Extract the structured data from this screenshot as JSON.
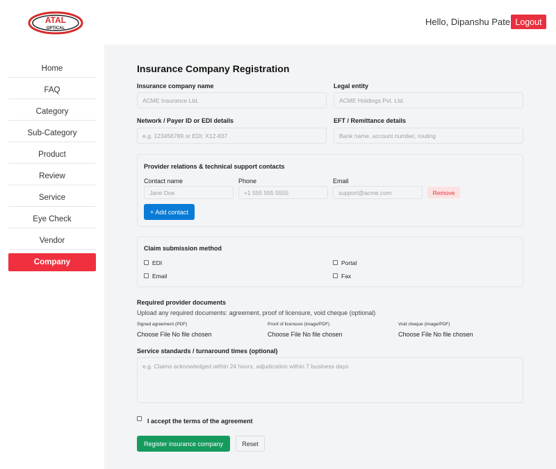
{
  "brand": {
    "logo_top": "ATAL",
    "logo_bottom": "OPTICAL"
  },
  "header": {
    "greeting": "Hello, Dipanshu Patel",
    "logout_label": "Logout"
  },
  "sidebar": {
    "items": [
      {
        "label": "Home"
      },
      {
        "label": "FAQ"
      },
      {
        "label": "Category"
      },
      {
        "label": "Sub-Category"
      },
      {
        "label": "Product"
      },
      {
        "label": "Review"
      },
      {
        "label": "Service"
      },
      {
        "label": "Eye Check"
      },
      {
        "label": "Vendor"
      },
      {
        "label": "Company"
      }
    ],
    "active_index": 9
  },
  "form": {
    "title": "Insurance Company Registration",
    "company_name": {
      "label": "Insurance company name",
      "placeholder": "ACME Insurance Ltd."
    },
    "legal_entity": {
      "label": "Legal entity",
      "placeholder": "ACME Holdings Pvt. Ltd."
    },
    "network": {
      "label": "Network / Payer ID or EDI details",
      "placeholder": "e.g. 123456789 or EDI: X12-837"
    },
    "eft": {
      "label": "EFT / Remittance details",
      "placeholder": "Bank name, account number, routing"
    },
    "contacts": {
      "title": "Provider relations & technical support contacts",
      "col_name": "Contact name",
      "col_phone": "Phone",
      "col_email": "Email",
      "name_placeholder": "Jane Doe",
      "phone_placeholder": "+1 555 555 5555",
      "email_placeholder": "support@acme.com",
      "remove_label": "Remove",
      "add_label": "+ Add contact"
    },
    "claims": {
      "title": "Claim submission method",
      "options": [
        {
          "label": "EDI",
          "checked": false
        },
        {
          "label": "Portal",
          "checked": false
        },
        {
          "label": "Email",
          "checked": false
        },
        {
          "label": "Fax",
          "checked": false
        }
      ]
    },
    "documents": {
      "title": "Required provider documents",
      "hint": "Upload any required documents: agreement, proof of licensure, void cheque (optional)",
      "files": [
        {
          "label": "Signed agreement (PDF)",
          "button": "Choose File",
          "status": "No file chosen"
        },
        {
          "label": "Proof of licensure (image/PDF)",
          "button": "Choose File",
          "status": "No file chosen"
        },
        {
          "label": "Void cheque (image/PDF)",
          "button": "Choose File",
          "status": "No file chosen"
        }
      ]
    },
    "standards": {
      "label": "Service standards / turnaround times (optional)",
      "placeholder": "e.g. Claims acknowledged within 24 hours, adjudication within 7 business days"
    },
    "terms_label": "I accept the terms of the agreement",
    "submit_label": "Register insurance company",
    "reset_label": "Reset"
  },
  "colors": {
    "accent_red": "#e8303e",
    "primary_blue": "#0a7bd6",
    "success_green": "#169a5e"
  }
}
